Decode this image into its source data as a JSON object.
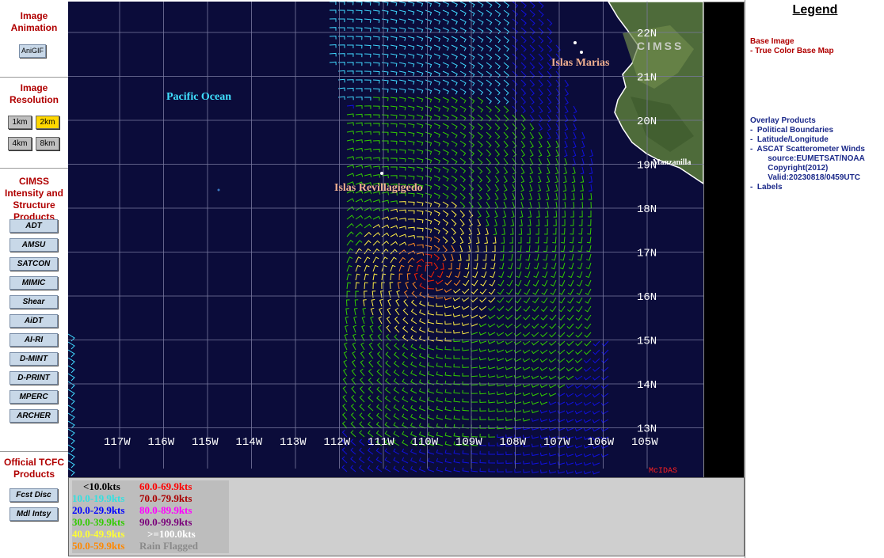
{
  "sidebar": {
    "animation_title": "Image Animation",
    "animgif_label": "AniGIF",
    "resolution_title": "Image Resolution",
    "resolutions": [
      "1km",
      "2km",
      "4km",
      "8km"
    ],
    "active_resolution": "2km",
    "cimss_title": "CIMSS Intensity and Structure Products",
    "products": [
      "ADT",
      "AMSU",
      "SATCON",
      "MIMIC",
      "Shear",
      "AiDT",
      "AI-RI",
      "D-MINT",
      "D-PRINT",
      "MPERC",
      "ARCHER"
    ],
    "tcfc_title": "Official TCFC Products",
    "tcfc_products": [
      "Fcst Disc",
      "Mdl Intsy"
    ]
  },
  "map": {
    "longitudes": [
      "117W",
      "116W",
      "115W",
      "114W",
      "113W",
      "112W",
      "111W",
      "110W",
      "109W",
      "108W",
      "107W",
      "106W",
      "105W"
    ],
    "latitudes": [
      "22N",
      "21N",
      "20N",
      "19N",
      "18N",
      "17N",
      "16N",
      "15N",
      "14N",
      "13N"
    ],
    "places": {
      "pacific": "Pacific Ocean",
      "marias": "Islas Marias",
      "revillagigedo": "Islas Revillagigedo",
      "manzanillo": "Manzanilla"
    },
    "watermark": "CIMSS",
    "mcidas": "McIDAS",
    "colors": {
      "ocean": "#0b0c3a",
      "grid": "#7a7aa0",
      "land": "#4e6b3a"
    }
  },
  "speed_legend": [
    {
      "label": "<10.0kts",
      "color": "#000000"
    },
    {
      "label": "10.0-19.9kts",
      "color": "#33e0e0"
    },
    {
      "label": "20.0-29.9kts",
      "color": "#0000ff"
    },
    {
      "label": "30.0-39.9kts",
      "color": "#33cc00"
    },
    {
      "label": "40.0-49.9kts",
      "color": "#ffff33"
    },
    {
      "label": "50.0-59.9kts",
      "color": "#ff8800"
    },
    {
      "label": "60.0-69.9kts",
      "color": "#ff0000"
    },
    {
      "label": "70.0-79.9kts",
      "color": "#aa0000"
    },
    {
      "label": "80.0-89.9kts",
      "color": "#ff00ff"
    },
    {
      "label": "90.0-99.9kts",
      "color": "#7a007a"
    },
    {
      "label": ">=100.0kts",
      "color": "#ffffff"
    },
    {
      "label": "Rain Flagged",
      "color": "#8a8a8a"
    }
  ],
  "legend": {
    "title": "Legend",
    "base_heading": "Base Image",
    "base_item": "-  True Color Base Map",
    "overlay_heading": "Overlay Products",
    "overlay_items": [
      "-  Political Boundaries",
      "-  Latitude/Longitude",
      "-  ASCAT Scatterometer Winds",
      "        source:EUMETSAT/NOAA",
      "        Copyright(2012)",
      "        Valid:20230818/0459UTC",
      "-  Labels"
    ]
  }
}
